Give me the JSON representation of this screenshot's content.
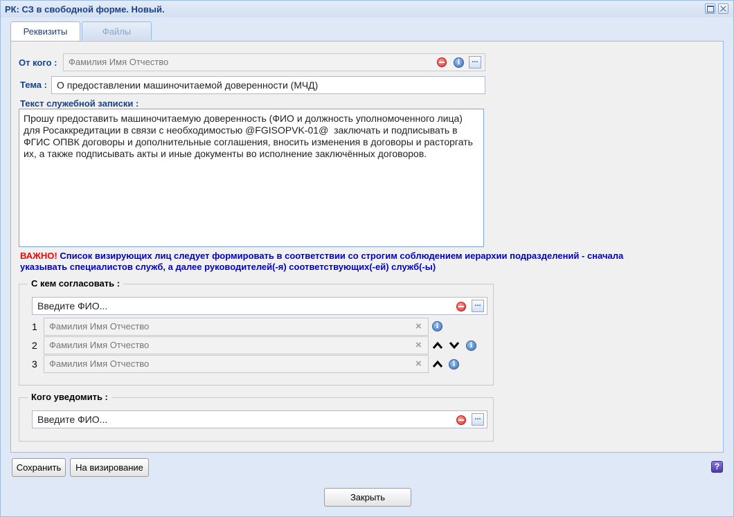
{
  "window": {
    "title": "РК: СЗ в свободной форме. Новый."
  },
  "tabs": [
    {
      "label": "Реквизиты",
      "active": true
    },
    {
      "label": "Файлы",
      "active": false
    }
  ],
  "from": {
    "label": "От кого :",
    "value": "Фамилия Имя Отчество"
  },
  "subject": {
    "label": "Тема :",
    "value": "О предоставлении машиночитаемой доверенности (МЧД)"
  },
  "memo": {
    "label": "Текст служебной записки :",
    "value": "Прошу предоставить машиночитаемую доверенность (ФИО и должность уполномоченного лица) для Росаккредитации в связи с необходимостью @FGISOPVK-01@  заключать и подписывать в ФГИС ОПВК договоры и дополнительные соглашения, вносить изменения в договоры и расторгать их, а также подписывать акты и иные документы во исполнение заключённых договоров."
  },
  "notice": {
    "important": "ВАЖНО!",
    "text": " Список визирующих лиц следует формировать в соответствии со строгим соблюдением иерархии подразделений - сначала указывать специалистов служб, а далее руководителей(-я) соответствующих(-ей) служб(-ы)"
  },
  "approvers": {
    "legend": "С кем согласовать :",
    "placeholder": "Введите ФИО...",
    "rows": [
      {
        "num": "1",
        "name": "Фамилия Имя Отчество"
      },
      {
        "num": "2",
        "name": "Фамилия Имя Отчество"
      },
      {
        "num": "3",
        "name": "Фамилия Имя Отчество"
      }
    ]
  },
  "notify": {
    "legend": "Кого уведомить :",
    "placeholder": "Введите ФИО..."
  },
  "buttons": {
    "save": "Сохранить",
    "send": "На визирование",
    "close": "Закрыть",
    "help": "?"
  },
  "icons": {
    "info": "i",
    "dots": "..."
  }
}
